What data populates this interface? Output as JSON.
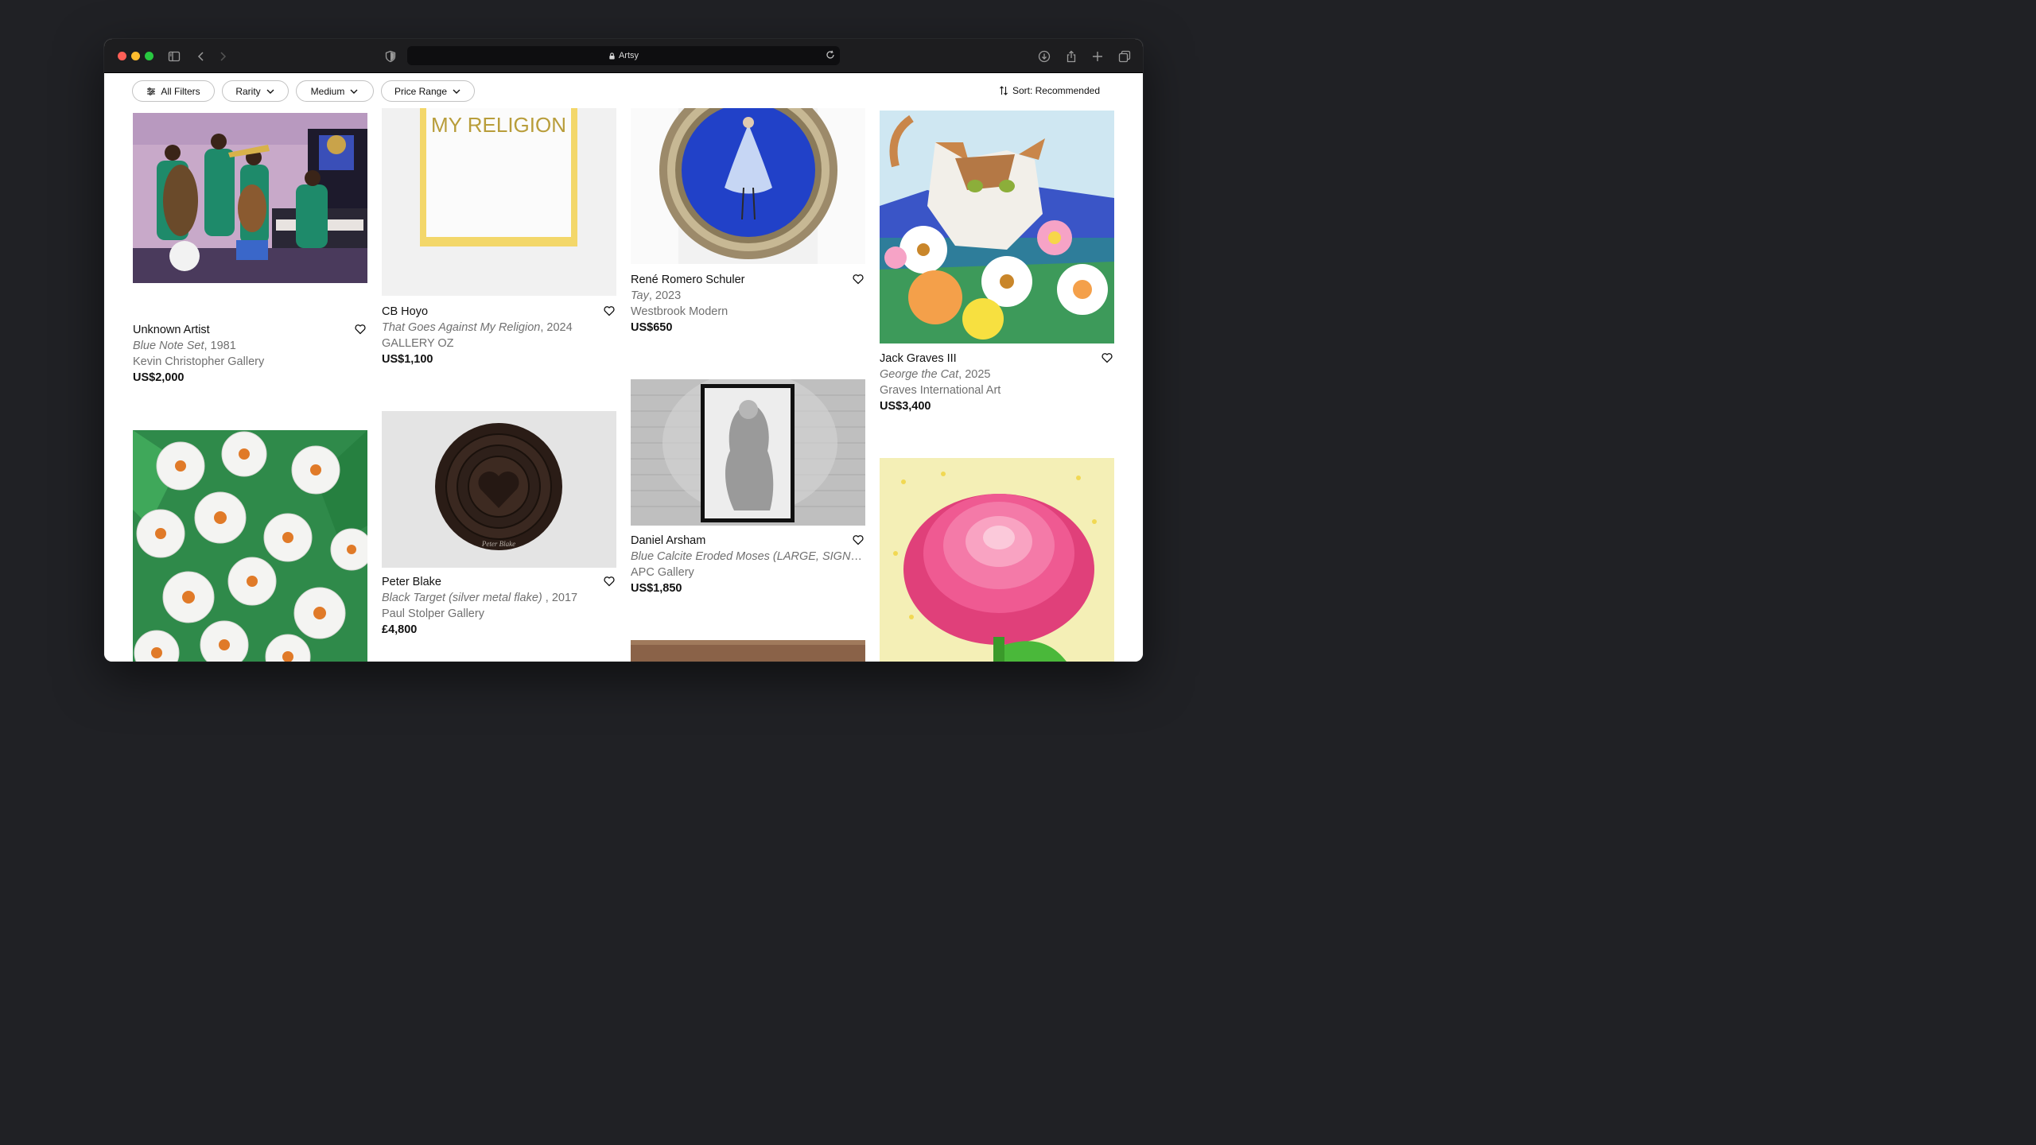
{
  "browser": {
    "address": "Artsy",
    "icons": [
      "sidebar-icon",
      "back-icon",
      "forward-icon",
      "privacy-shield-icon",
      "lock-icon",
      "reload-icon",
      "download-icon",
      "share-icon",
      "new-tab-icon",
      "tabs-overview-icon"
    ]
  },
  "filters": {
    "all_filters": "All Filters",
    "rarity": "Rarity",
    "medium": "Medium",
    "price_range": "Price Range",
    "sort": "Sort: Recommended"
  },
  "artworks": [
    {
      "artist": "Unknown Artist",
      "title": "Blue Note Set",
      "year": ", 1981",
      "gallery": "Kevin Christopher Gallery",
      "price": "US$2,000"
    },
    {
      "artist": "CB Hoyo",
      "title": "That Goes Against My Religion",
      "year": ", 2024",
      "gallery": "GALLERY OZ",
      "price": "US$1,100"
    },
    {
      "artist": "René Romero Schuler",
      "title": "Tay",
      "year": ", 2023",
      "gallery": "Westbrook Modern",
      "price": "US$650"
    },
    {
      "artist": "Jack Graves III",
      "title": "George the Cat",
      "year": ", 2025",
      "gallery": "Graves International Art",
      "price": "US$3,400"
    },
    {
      "artist": "Peter Blake",
      "title": "Black Target (silver metal flake) ",
      "year": ", 2017",
      "gallery": "Paul Stolper Gallery",
      "price": "£4,800"
    },
    {
      "artist": "Daniel Arsham",
      "title": "Blue Calcite Eroded Moses (LARGE, SIGNE...",
      "year": "",
      "gallery": "APC Gallery",
      "price": "US$1,850"
    }
  ],
  "artwork_image_text": {
    "religion_sign": "MY RELIGION",
    "blake_signature": "Peter Blake"
  },
  "colors": {
    "window_bg": "#202125",
    "titlebar": "#1d1d1f",
    "text_primary": "#111111",
    "text_secondary": "#707070"
  }
}
